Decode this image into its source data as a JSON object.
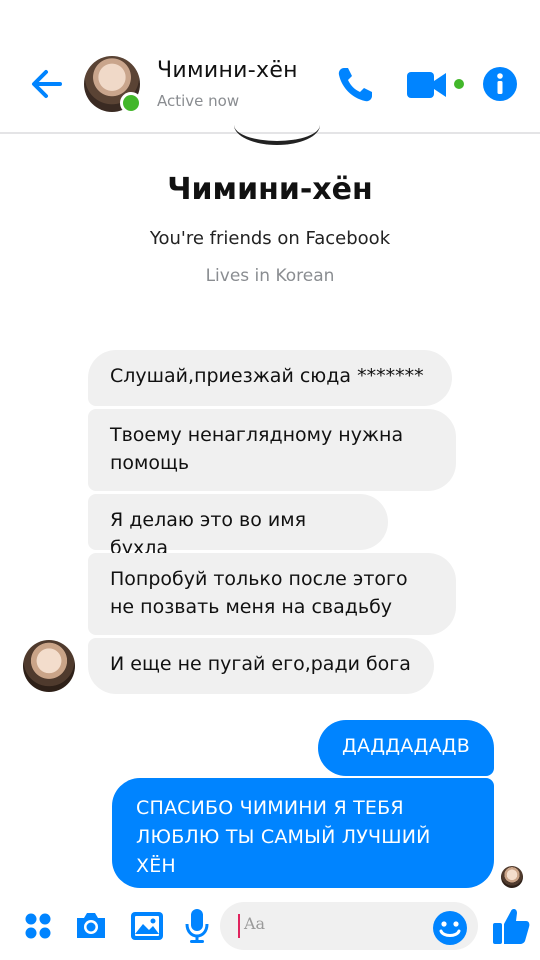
{
  "header": {
    "contact_name": "Чимини-хён",
    "status": "Active now"
  },
  "profile": {
    "name": "Чимини-хён",
    "friends_text": "You're friends on Facebook",
    "lives_text": "Lives in Korean"
  },
  "messages": [
    {
      "direction": "incoming",
      "text": "Слушай,приезжай сюда *******"
    },
    {
      "direction": "incoming",
      "text": "Твоему ненаглядному нужна помощь"
    },
    {
      "direction": "incoming",
      "text": "Я делаю это во имя бухла"
    },
    {
      "direction": "incoming",
      "text": "Попробуй только после этого не позвать меня на свадьбу"
    },
    {
      "direction": "incoming",
      "text": "И еще не пугай его,ради бога"
    },
    {
      "direction": "outgoing",
      "text": "ДАДДАДАДВ"
    },
    {
      "direction": "outgoing",
      "text": "СПАСИБО ЧИМИНИ Я ТЕБЯ ЛЮБЛЮ ТЫ САМЫЙ ЛУЧШИЙ ХЁН"
    }
  ],
  "composer": {
    "placeholder": "Aa"
  },
  "colors": {
    "accent": "#0084ff",
    "online": "#42b72a",
    "incoming_bubble": "#f0f0f0"
  },
  "icons": {
    "back": "arrow-left-icon",
    "call": "phone-icon",
    "video": "video-camera-icon",
    "info": "info-icon",
    "more": "four-dots-icon",
    "camera": "camera-icon",
    "gallery": "image-icon",
    "mic": "microphone-icon",
    "emoji": "smiley-icon",
    "like": "thumbs-up-icon"
  }
}
